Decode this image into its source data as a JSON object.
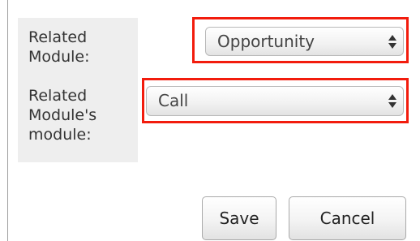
{
  "form": {
    "related_module_label": "Related\nModule:",
    "related_submodule_label": "Related\nModule's\nmodule:",
    "related_module_value": "Opportunity",
    "related_submodule_value": "Call"
  },
  "actions": {
    "save_label": "Save",
    "cancel_label": "Cancel"
  },
  "colors": {
    "highlight": "#f21c0d",
    "label_background": "#eeeeee"
  },
  "icons": {
    "select_arrows": "up-down-arrows-icon"
  }
}
